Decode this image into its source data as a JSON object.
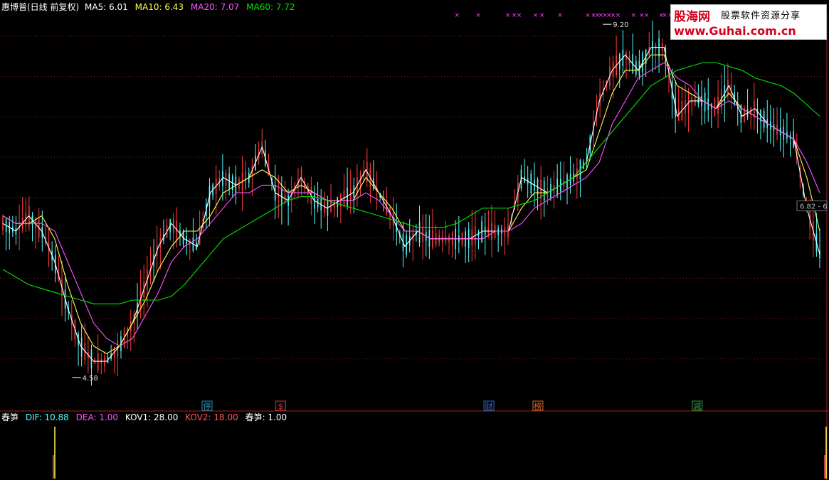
{
  "header": {
    "title": "惠博普(日线 前复权)",
    "ma5": "MA5: 6.01",
    "ma10": "MA10: 6.43",
    "ma20": "MA20: 7.07",
    "ma60": "MA60: 7.72"
  },
  "sub_header": {
    "name": "春笋",
    "dif": "DIF: 10.88",
    "dea": "DEA: 1.00",
    "kov1": "KOV1: 28.00",
    "kov2": "KOV2: 18.00",
    "cs": "春笋: 1.00"
  },
  "watermark": {
    "brand": "股海网",
    "slogan": "股票软件资源分享",
    "url": "www.Guhai.com.cn"
  },
  "colors": {
    "background": "#000000",
    "up": "#ff3c3c",
    "down": "#54ffff",
    "ma5": "#ffffff",
    "ma10": "#ffff54",
    "ma20": "#ff54ff",
    "ma60": "#00e600",
    "grid": "#8a1a1a",
    "markers": "#ff40ff"
  },
  "chart_data": [
    {
      "type": "candlestick",
      "title": "惠博普(日线 前复权)",
      "ylim": [
        4.3,
        9.35
      ],
      "grid": true,
      "annotations": [
        {
          "label": "9.20",
          "type": "high"
        },
        {
          "label": "4.58",
          "type": "low"
        },
        {
          "label": "6.82",
          "type": "price-tag"
        }
      ],
      "event_labels": [
        "停",
        "$",
        "财",
        "榜",
        "减"
      ],
      "event_positions": [
        0.25,
        0.34,
        0.595,
        0.655,
        0.85
      ],
      "marker_positions": [
        0.556,
        0.582,
        0.618,
        0.626,
        0.632,
        0.652,
        0.66,
        0.682,
        0.716,
        0.723,
        0.728,
        0.732,
        0.737,
        0.742,
        0.747,
        0.753,
        0.772,
        0.782,
        0.788,
        0.806,
        0.81,
        0.817
      ],
      "series": [
        {
          "name": "MA5",
          "values": [
            6.6,
            6.5,
            6.7,
            6.5,
            6.1,
            5.5,
            5.0,
            4.8,
            4.8,
            5.0,
            5.3,
            5.8,
            6.3,
            6.6,
            6.4,
            6.3,
            7.0,
            7.2,
            7.1,
            7.2,
            7.6,
            7.0,
            6.9,
            7.2,
            6.9,
            6.8,
            6.9,
            7.0,
            7.3,
            7.0,
            6.7,
            6.3,
            6.5,
            6.4,
            6.4,
            6.4,
            6.4,
            6.5,
            6.5,
            6.5,
            7.2,
            7.1,
            7.0,
            7.1,
            7.2,
            7.4,
            8.2,
            8.6,
            8.8,
            8.6,
            8.9,
            8.9,
            8.0,
            8.2,
            8.2,
            8.1,
            8.4,
            8.0,
            8.1,
            7.9,
            7.8,
            7.7,
            6.8,
            6.2
          ]
        },
        {
          "name": "MA10",
          "values": [
            6.7,
            6.6,
            6.6,
            6.7,
            6.4,
            5.8,
            5.3,
            5.0,
            4.9,
            5.0,
            5.3,
            5.6,
            6.0,
            6.3,
            6.5,
            6.5,
            6.7,
            7.0,
            7.1,
            7.2,
            7.3,
            7.2,
            7.0,
            7.1,
            7.0,
            6.9,
            6.9,
            6.9,
            7.2,
            7.0,
            6.8,
            6.5,
            6.5,
            6.4,
            6.4,
            6.4,
            6.4,
            6.4,
            6.5,
            6.5,
            6.8,
            7.0,
            7.0,
            7.1,
            7.2,
            7.3,
            7.8,
            8.3,
            8.6,
            8.6,
            8.8,
            8.8,
            8.4,
            8.3,
            8.2,
            8.1,
            8.3,
            8.1,
            8.0,
            7.9,
            7.8,
            7.7,
            7.2,
            6.5
          ]
        },
        {
          "name": "MA20",
          "values": [
            6.7,
            6.6,
            6.6,
            6.6,
            6.5,
            6.1,
            5.7,
            5.3,
            5.1,
            5.0,
            5.1,
            5.4,
            5.7,
            6.1,
            6.3,
            6.4,
            6.6,
            6.8,
            7.0,
            7.0,
            7.1,
            7.1,
            7.0,
            7.0,
            7.0,
            6.9,
            6.9,
            6.9,
            7.0,
            6.9,
            6.7,
            6.5,
            6.5,
            6.4,
            6.4,
            6.4,
            6.4,
            6.4,
            6.5,
            6.5,
            6.6,
            6.8,
            6.9,
            7.0,
            7.1,
            7.2,
            7.4,
            7.9,
            8.2,
            8.5,
            8.6,
            8.7,
            8.5,
            8.4,
            8.2,
            8.1,
            8.2,
            8.1,
            8.0,
            7.9,
            7.8,
            7.7,
            7.4,
            7.0
          ]
        },
        {
          "name": "MA60",
          "values": [
            6.0,
            5.9,
            5.8,
            5.75,
            5.7,
            5.65,
            5.6,
            5.55,
            5.55,
            5.55,
            5.6,
            5.6,
            5.6,
            5.65,
            5.8,
            6.0,
            6.2,
            6.4,
            6.5,
            6.6,
            6.7,
            6.8,
            6.9,
            6.95,
            6.95,
            6.9,
            6.85,
            6.8,
            6.75,
            6.7,
            6.65,
            6.6,
            6.55,
            6.55,
            6.55,
            6.6,
            6.7,
            6.8,
            6.8,
            6.8,
            6.85,
            6.9,
            7.0,
            7.1,
            7.2,
            7.4,
            7.6,
            7.8,
            8.0,
            8.2,
            8.4,
            8.5,
            8.6,
            8.65,
            8.7,
            8.7,
            8.65,
            8.6,
            8.5,
            8.45,
            8.4,
            8.3,
            8.15,
            8.0
          ]
        }
      ]
    },
    {
      "type": "bar",
      "title": "春笋",
      "series": [
        {
          "name": "春笋",
          "values": [
            0,
            0,
            0,
            0,
            0,
            0,
            0,
            0,
            0,
            0,
            0,
            0,
            0,
            0,
            0,
            0,
            0,
            0,
            0,
            0,
            0,
            0,
            0,
            0,
            0,
            0,
            0,
            0,
            0,
            0,
            0,
            0,
            0,
            0,
            0,
            0,
            0,
            0,
            0,
            0,
            0,
            0,
            0,
            0,
            0,
            0,
            0,
            0,
            0,
            0,
            0,
            0,
            0,
            0,
            0,
            0,
            0,
            0,
            0,
            0,
            0,
            0,
            0,
            1
          ]
        }
      ],
      "spike_positions": [
        0.066,
        0.998
      ],
      "ylim": [
        0,
        1
      ]
    }
  ]
}
